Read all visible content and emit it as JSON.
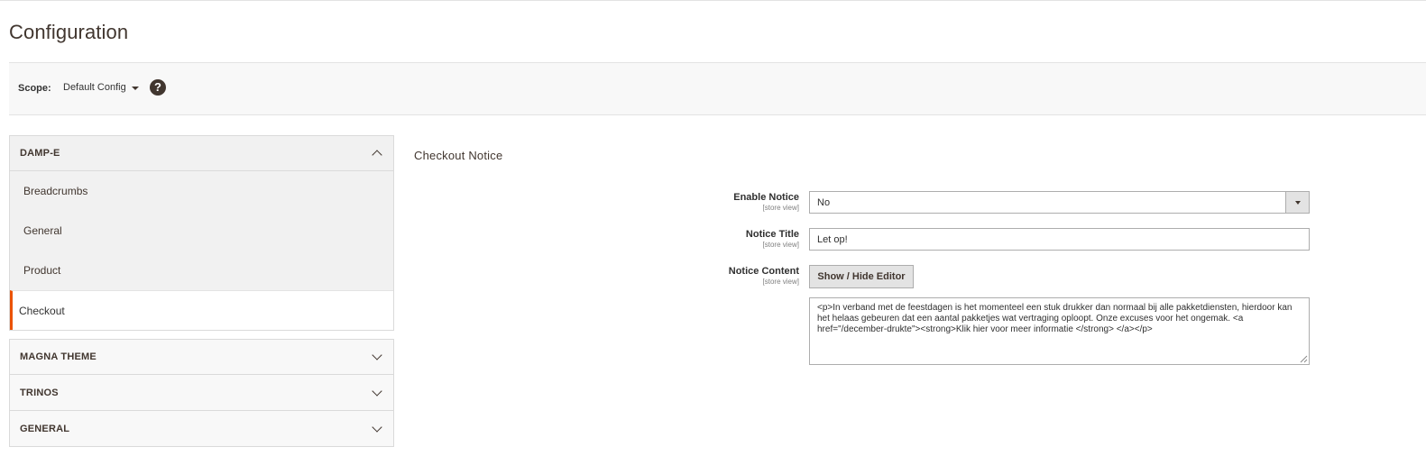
{
  "page": {
    "title": "Configuration"
  },
  "scope": {
    "label": "Scope:",
    "value": "Default Config"
  },
  "sidebar": {
    "sections": [
      {
        "label": "DAMP-E",
        "expanded": true,
        "items": [
          {
            "label": "Breadcrumbs",
            "active": false
          },
          {
            "label": "General",
            "active": false
          },
          {
            "label": "Product",
            "active": false
          },
          {
            "label": "Checkout",
            "active": true
          }
        ]
      },
      {
        "label": "MAGNA THEME",
        "expanded": false
      },
      {
        "label": "TRINOS",
        "expanded": false
      },
      {
        "label": "GENERAL",
        "expanded": false
      }
    ]
  },
  "content": {
    "title": "Checkout Notice",
    "fields": {
      "enable_notice": {
        "label": "Enable Notice",
        "scope": "[store view]",
        "value": "No"
      },
      "notice_title": {
        "label": "Notice Title",
        "scope": "[store view]",
        "value": "Let op!"
      },
      "notice_content": {
        "label": "Notice Content",
        "scope": "[store view]",
        "editor_button": "Show / Hide Editor",
        "value": "<p>In verband met de feestdagen is het momenteel een stuk drukker dan normaal bij alle pakketdiensten, hierdoor kan het helaas gebeuren dat een aantal pakketjes wat vertraging oploopt. Onze excuses voor het ongemak. <a href=\"/december-drukte\"><strong>Klik hier voor meer informatie </strong> </a></p>"
      }
    }
  },
  "colors": {
    "accent": "#eb5202",
    "text_dark": "#41362f",
    "panel_bg": "#f1f1f1"
  },
  "icons": {
    "help": "question-circle-icon",
    "section_expanded": "chevron-up-icon",
    "section_collapsed": "chevron-down-icon"
  }
}
